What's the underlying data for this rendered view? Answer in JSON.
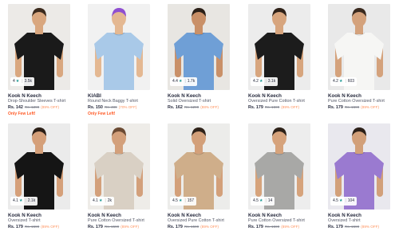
{
  "products": [
    {
      "brand": "Kook N Keech",
      "title": "Drop-Shoulder Sleeves T-shirt",
      "price": "Rs. 142",
      "mrp": "Rs. 1299",
      "off": "(89% OFF)",
      "rating": "4",
      "count": "3.5k",
      "flag": "Only Few Left!",
      "shirt": "#1a1a1a",
      "bg": "#eceae7",
      "skin": "#d9a77f",
      "hair": "#3b2a1d"
    },
    {
      "brand": "KIABI",
      "title": "Round Neck Baggy T-shirt",
      "price": "Rs. 150",
      "mrp": "Rs. 499",
      "off": "(70% OFF)",
      "rating": "",
      "count": "",
      "flag": "Only Few Left!",
      "shirt": "#a9c9e8",
      "bg": "#f1f1f1",
      "skin": "#e4b892",
      "hair": "#8f4fd1"
    },
    {
      "brand": "Kook N Keech",
      "title": "Solid Oversized T-shirt",
      "price": "Rs. 162",
      "mrp": "Rs. 1299",
      "off": "(88% OFF)",
      "rating": "4.4",
      "count": "1.7k",
      "flag": "",
      "shirt": "#6f9fd6",
      "bg": "#e8e6e2",
      "skin": "#c99068",
      "hair": "#2b2018"
    },
    {
      "brand": "Kook N Keech",
      "title": "Oversized Pure Cotton T-shirt",
      "price": "Rs. 179",
      "mrp": "Rs. 1599",
      "off": "(89% OFF)",
      "rating": "4.2",
      "count": "3.1k",
      "flag": "",
      "shirt": "#1c1c1c",
      "bg": "#ececec",
      "skin": "#d7a57e",
      "hair": "#2e2118"
    },
    {
      "brand": "Kook N Keech",
      "title": "Pure Cotton Oversized T-shirt",
      "price": "Rs. 179",
      "mrp": "Rs. 1599",
      "off": "(89% OFF)",
      "rating": "4.2",
      "count": "603",
      "flag": "",
      "shirt": "#f6f6f4",
      "bg": "#e9e9e9",
      "skin": "#d4a27c",
      "hair": "#3a2a1f"
    },
    {
      "brand": "Kook N Keech",
      "title": "Oversized T-shirt",
      "price": "Rs. 179",
      "mrp": "Rs. 1599",
      "off": "(89% OFF)",
      "rating": "4.1",
      "count": "2.1k",
      "flag": "",
      "shirt": "#151515",
      "bg": "#ebebeb",
      "skin": "#d5a07a",
      "hair": "#2a1e16"
    },
    {
      "brand": "Kook N Keech",
      "title": "Pure Cotton Oversized T-shirt",
      "price": "Rs. 179",
      "mrp": "Rs. 1599",
      "off": "(89% OFF)",
      "rating": "4.1",
      "count": "2k",
      "flag": "",
      "shirt": "#d9d0c4",
      "bg": "#eeece8",
      "skin": "#d3a07b",
      "hair": "#6b4a33"
    },
    {
      "brand": "Kook N Keech",
      "title": "Oversized Pure Cotton T-shirt",
      "price": "Rs. 179",
      "mrp": "Rs. 1599",
      "off": "(89% OFF)",
      "rating": "4.5",
      "count": "157",
      "flag": "",
      "shirt": "#cfae8a",
      "bg": "#ececea",
      "skin": "#d3a07a",
      "hair": "#2f2219"
    },
    {
      "brand": "Kook N Keech",
      "title": "Pure Cotton Oversized T-shirt",
      "price": "Rs. 179",
      "mrp": "Rs. 1599",
      "off": "(89% OFF)",
      "rating": "4.5",
      "count": "14",
      "flag": "",
      "shirt": "#a8a8a6",
      "bg": "#ededed",
      "skin": "#d6a37c",
      "hair": "#2d2118"
    },
    {
      "brand": "Kook N Keech",
      "title": "Oversized T-shirt",
      "price": "Rs. 179",
      "mrp": "Rs. 1599",
      "off": "(89% OFF)",
      "rating": "4.5",
      "count": "104",
      "flag": "",
      "shirt": "#9a7ad0",
      "bg": "#e9e8ee",
      "skin": "#d2a07a",
      "hair": "#2c2018"
    }
  ],
  "colors": {
    "rating_star": "#14958f",
    "discount": "#ff905a",
    "flag": "#ff5722"
  }
}
